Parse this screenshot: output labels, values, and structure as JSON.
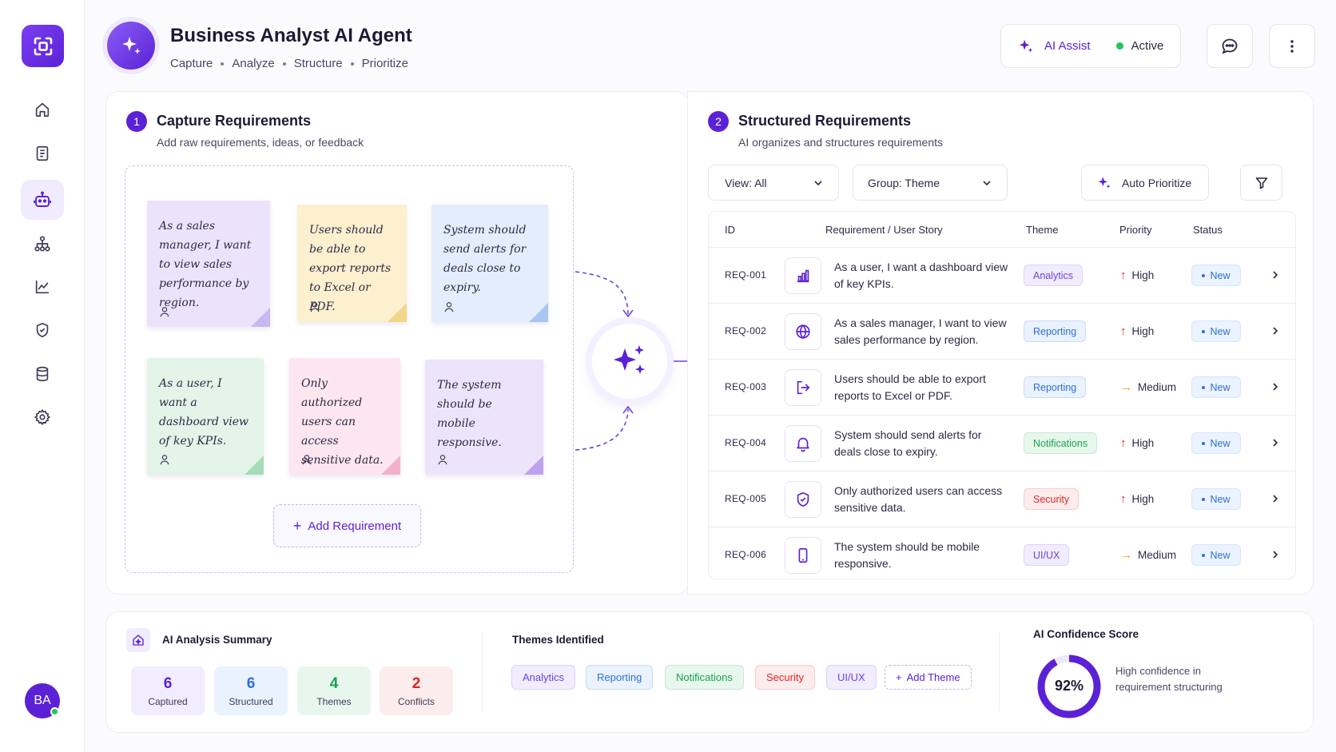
{
  "app": {
    "title": "Business Analyst AI Agent",
    "subtitle": [
      "Capture",
      "Analyze",
      "Structure",
      "Prioritize"
    ]
  },
  "header": {
    "assist_label": "AI Assist",
    "status_label": "Active"
  },
  "sidebar": {
    "items": [
      {
        "icon": "home-icon"
      },
      {
        "icon": "document-icon"
      },
      {
        "icon": "robot-icon",
        "active": true
      },
      {
        "icon": "hierarchy-icon"
      },
      {
        "icon": "chart-icon"
      },
      {
        "icon": "shield-icon"
      },
      {
        "icon": "database-icon"
      },
      {
        "icon": "gear-icon"
      }
    ],
    "avatar_initials": "BA"
  },
  "capture": {
    "step": "1",
    "title": "Capture Requirements",
    "subtitle": "Add raw requirements, ideas, or feedback",
    "notes": [
      {
        "text": "As a sales manager, I want to view sales performance by region.",
        "color": "#ebe3fb"
      },
      {
        "text": "Users should be able to export reports to Excel or PDF.",
        "color": "#fdf0cf"
      },
      {
        "text": "System should send alerts for deals close to expiry.",
        "color": "#e3edfb"
      },
      {
        "text": "As a user, I want a dashboard view of key KPIs.",
        "color": "#e2f5e8"
      },
      {
        "text": "Only authorized users can access sensitive data.",
        "color": "#fde6ef"
      },
      {
        "text": "The system should be mobile responsive.",
        "color": "#ece4fb"
      }
    ],
    "add_button": "Add Requirement"
  },
  "structured": {
    "step": "2",
    "title": "Structured Requirements",
    "subtitle": "AI organizes and structures requirements",
    "view_select": "View: All",
    "group_select": "Group: Theme",
    "auto_prioritize": "Auto Prioritize",
    "columns": [
      "ID",
      "Requirement / User Story",
      "Theme",
      "Priority",
      "Status"
    ],
    "rows": [
      {
        "id": "REQ-001",
        "icon": "bar-chart-icon",
        "text": "As a user, I want a dashboard view of key KPIs.",
        "theme": "Analytics",
        "priority": "High",
        "status": "New"
      },
      {
        "id": "REQ-002",
        "icon": "globe-icon",
        "text": "As a sales manager, I want to view sales performance by region.",
        "theme": "Reporting",
        "priority": "High",
        "status": "New"
      },
      {
        "id": "REQ-003",
        "icon": "export-icon",
        "text": "Users should be able to export reports to Excel or PDF.",
        "theme": "Reporting",
        "priority": "Medium",
        "status": "New"
      },
      {
        "id": "REQ-004",
        "icon": "bell-icon",
        "text": "System should send alerts for deals close to expiry.",
        "theme": "Notifications",
        "priority": "High",
        "status": "New"
      },
      {
        "id": "REQ-005",
        "icon": "shield-check-icon",
        "text": "Only authorized users can access sensitive data.",
        "theme": "Security",
        "priority": "High",
        "status": "New"
      },
      {
        "id": "REQ-006",
        "icon": "mobile-icon",
        "text": "The system should be mobile responsive.",
        "theme": "UI/UX",
        "priority": "Medium",
        "status": "New"
      }
    ]
  },
  "summary": {
    "title": "AI Analysis Summary",
    "stats": [
      {
        "value": "6",
        "label": "Captured",
        "color": "#5b21d6",
        "bg": "#f1ecff"
      },
      {
        "value": "6",
        "label": "Structured",
        "color": "#2d6fd6",
        "bg": "#eaf2fe"
      },
      {
        "value": "4",
        "label": "Themes",
        "color": "#16a34a",
        "bg": "#e8f7ee"
      },
      {
        "value": "2",
        "label": "Conflicts",
        "color": "#dc2626",
        "bg": "#fdecec"
      }
    ],
    "themes_title": "Themes Identified",
    "themes": [
      "Analytics",
      "Reporting",
      "Notifications",
      "Security",
      "UI/UX"
    ],
    "add_theme": "Add Theme",
    "confidence_title": "AI Confidence Score",
    "confidence_value": "92%",
    "confidence_fraction": 0.92,
    "confidence_text": "High confidence in requirement structuring"
  },
  "colors": {
    "accent": "#5b21d6",
    "analytics": "#6d42e0",
    "reporting": "#2d6fd6",
    "notifications": "#16a34a",
    "security": "#dc2626",
    "uiux": "#6d42e0",
    "high": "#dc2626",
    "medium": "#f59e0b"
  }
}
